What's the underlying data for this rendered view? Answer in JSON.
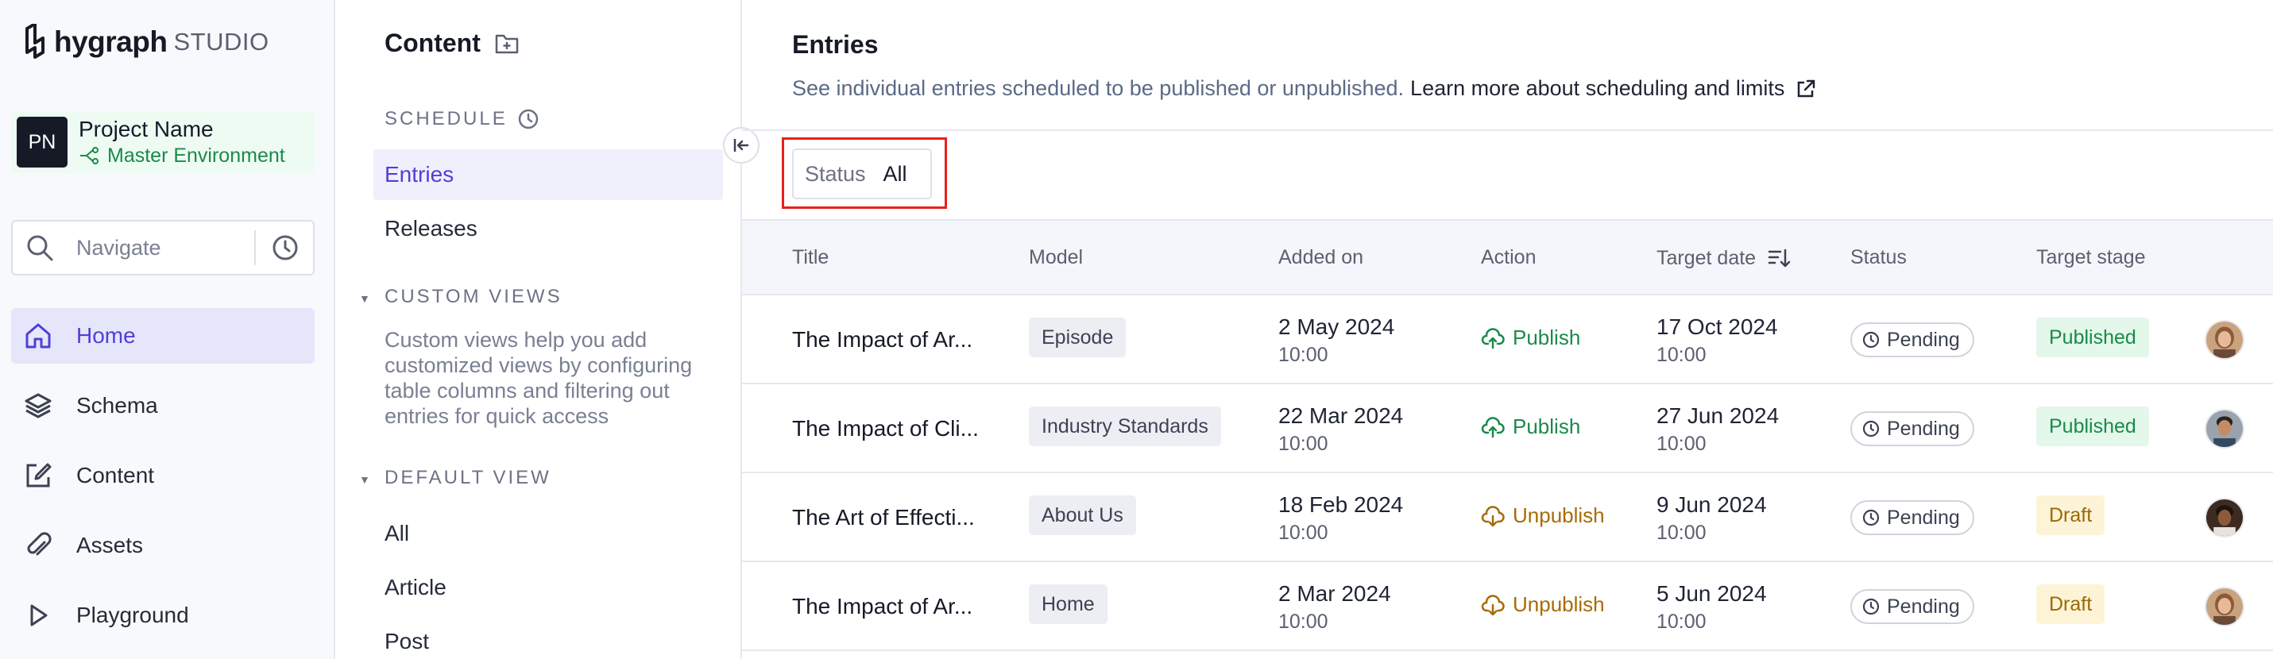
{
  "nav": {
    "brand": "hygraph",
    "studio": "STUDIO",
    "project": {
      "initials": "PN",
      "name": "Project Name",
      "environment": "Master Environment"
    },
    "search_label": "Navigate",
    "items": [
      {
        "label": "Home",
        "icon": "home-icon"
      },
      {
        "label": "Schema",
        "icon": "layers-icon"
      },
      {
        "label": "Content",
        "icon": "edit-icon"
      },
      {
        "label": "Assets",
        "icon": "paperclip-icon"
      },
      {
        "label": "Playground",
        "icon": "play-icon"
      }
    ]
  },
  "content_sidebar": {
    "title": "Content",
    "schedule_heading": "SCHEDULE",
    "schedule_items": [
      "Entries",
      "Releases"
    ],
    "custom_views_heading": "CUSTOM VIEWS",
    "custom_views_description": "Custom views help you add customized views by configuring table columns and filtering out entries for quick access",
    "default_view_heading": "DEFAULT VIEW",
    "default_view_items": [
      "All",
      "Article",
      "Post"
    ]
  },
  "main": {
    "title": "Entries",
    "description": "See individual entries scheduled to be published or unpublished.",
    "learn_more": "Learn more about scheduling and limits",
    "filter": {
      "label": "Status",
      "value": "All"
    },
    "columns": [
      "Title",
      "Model",
      "Added on",
      "Action",
      "Target date",
      "Status",
      "Target stage"
    ],
    "rows": [
      {
        "title": "The Impact of Ar...",
        "model": "Episode",
        "added_date": "2 May 2024",
        "added_time": "10:00",
        "action": "Publish",
        "target_date": "17 Oct 2024",
        "target_time": "10:00",
        "status": "Pending",
        "stage": "Published"
      },
      {
        "title": "The Impact of Cli...",
        "model": "Industry Standards",
        "added_date": "22 Mar 2024",
        "added_time": "10:00",
        "action": "Publish",
        "target_date": "27 Jun 2024",
        "target_time": "10:00",
        "status": "Pending",
        "stage": "Published"
      },
      {
        "title": "The Art of Effecti...",
        "model": "About Us",
        "added_date": "18 Feb 2024",
        "added_time": "10:00",
        "action": "Unpublish",
        "target_date": "9 Jun 2024",
        "target_time": "10:00",
        "status": "Pending",
        "stage": "Draft"
      },
      {
        "title": "The Impact of Ar...",
        "model": "Home",
        "added_date": "2 Mar 2024",
        "added_time": "10:00",
        "action": "Unpublish",
        "target_date": "5 Jun 2024",
        "target_time": "10:00",
        "status": "Pending",
        "stage": "Draft"
      }
    ]
  },
  "colors": {
    "accent": "#4f3fd8",
    "publish": "#1a8a4a",
    "unpublish": "#a86b07",
    "highlight_outline": "#e5231b"
  }
}
